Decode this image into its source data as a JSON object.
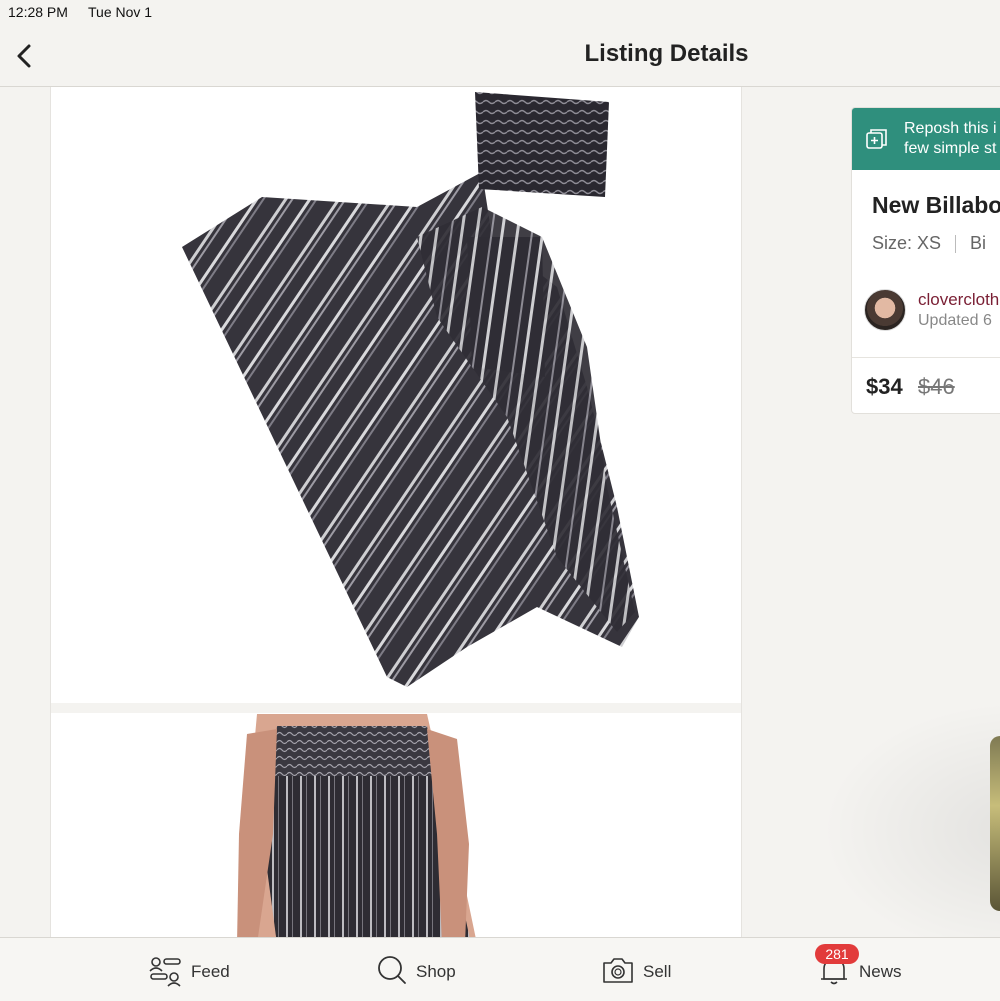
{
  "status": {
    "time": "12:28 PM",
    "date": "Tue Nov 1"
  },
  "nav": {
    "title": "Listing Details"
  },
  "listing": {
    "repost_text": "Reposh this i\nfew simple st",
    "title": "New Billabo",
    "size_label": "Size: XS",
    "brand_partial": "Bi",
    "seller": "clovercloth",
    "updated": "Updated 6",
    "price": "$34",
    "original_price": "$46"
  },
  "tabs": [
    {
      "label": "Feed"
    },
    {
      "label": "Shop"
    },
    {
      "label": "Sell"
    },
    {
      "label": "News",
      "badge": "281"
    }
  ],
  "colors": {
    "accent": "#2f8f7d",
    "seller": "#7a1f34",
    "badge": "#e23b3b",
    "fabric": "#36343c"
  }
}
